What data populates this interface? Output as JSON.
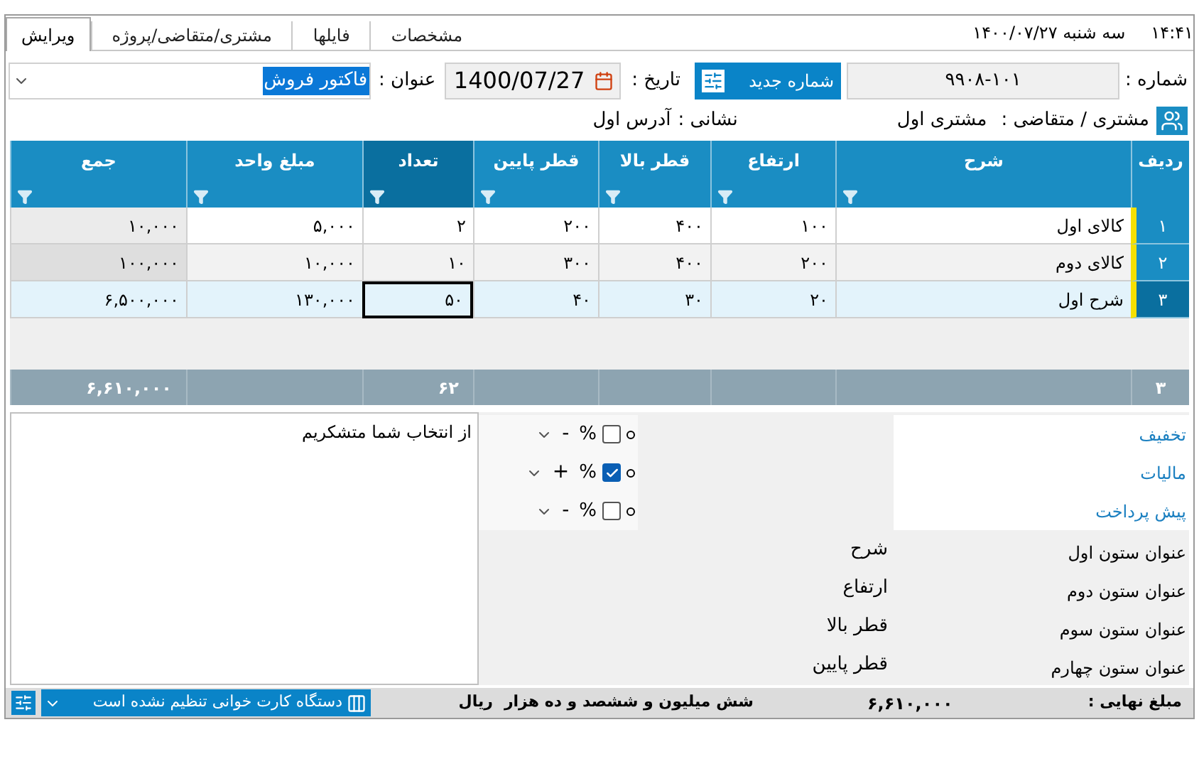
{
  "header": {
    "time": "۱۴:۴۱",
    "date": "سه شنبه  ۱۴۰۰/۰۷/۲۷"
  },
  "tabs": [
    {
      "label": "مشخصات",
      "selected": false
    },
    {
      "label": "فایلها",
      "selected": false
    },
    {
      "label": "مشتری/متقاضی/پروژه",
      "selected": false
    },
    {
      "label": "ویرایش",
      "selected": true
    }
  ],
  "form": {
    "number_label": "شماره :",
    "number": "۹۹۰۸-۱۰۱",
    "new_number_button": "شماره جدید",
    "date_label": "تاریخ :",
    "date": "1400/07/27",
    "title_label": "عنوان :",
    "title": "فاکتور فروش",
    "customer_label": "مشتری / متقاضی :",
    "customer": "مشتری اول",
    "address_label": "نشانی :",
    "address": "آدرس اول"
  },
  "table": {
    "columns": [
      {
        "label": "ردیف",
        "selected": false
      },
      {
        "label": "شرح",
        "selected": false
      },
      {
        "label": "ارتفاع",
        "selected": false
      },
      {
        "label": "قطر بالا",
        "selected": false
      },
      {
        "label": "قطر پایین",
        "selected": false
      },
      {
        "label": "تعداد",
        "selected": true
      },
      {
        "label": "مبلغ واحد",
        "selected": false
      },
      {
        "label": "جمع",
        "selected": false
      }
    ],
    "rows": [
      {
        "selected": false,
        "cells": [
          "۱",
          "کالای اول",
          "۱۰۰",
          "۴۰۰",
          "۲۰۰",
          "۲",
          "۵,۰۰۰",
          "۱۰,۰۰۰"
        ]
      },
      {
        "selected": false,
        "cells": [
          "۲",
          "کالای دوم",
          "۲۰۰",
          "۴۰۰",
          "۳۰۰",
          "۱۰",
          "۱۰,۰۰۰",
          "۱۰۰,۰۰۰"
        ]
      },
      {
        "selected": true,
        "cells": [
          "۳",
          "شرح اول",
          "۲۰",
          "۳۰",
          "۴۰",
          "۵۰",
          "۱۳۰,۰۰۰",
          "۶,۵۰۰,۰۰۰"
        ]
      }
    ],
    "footer": {
      "row_count": "۳",
      "quantity_total": "۶۲",
      "sum_total": "۶,۶۱۰,۰۰۰"
    }
  },
  "adjustments": [
    {
      "label": "تخفیف",
      "checked": false,
      "percent": "%",
      "sign": "-"
    },
    {
      "label": "مالیات",
      "checked": true,
      "percent": "%",
      "sign": "+"
    },
    {
      "label": "پیش پرداخت",
      "checked": false,
      "percent": "%",
      "sign": "-"
    }
  ],
  "column_titles": [
    {
      "label": "عنوان ستون اول",
      "value": "شرح"
    },
    {
      "label": "عنوان ستون دوم",
      "value": "ارتفاع"
    },
    {
      "label": "عنوان ستون سوم",
      "value": "قطر بالا"
    },
    {
      "label": "عنوان ستون چهارم",
      "value": "قطر پایین"
    }
  ],
  "notes": "از انتخاب شما متشکریم",
  "status_bar": {
    "final_label": "مبلغ نهایی :",
    "final_amount": "۶,۶۱۰,۰۰۰",
    "amount_words": "شش میلیون و ششصد و ده هزار",
    "currency": "ریال",
    "card_reader": "دستگاه کارت خوانی تنظیم نشده است"
  }
}
